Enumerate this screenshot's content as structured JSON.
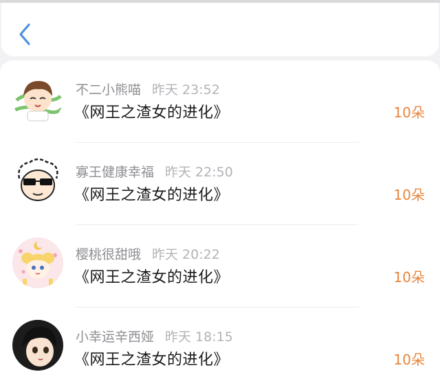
{
  "header": {
    "back_icon": "chevron-left-icon",
    "accent_color": "#4a90e2"
  },
  "list": {
    "items": [
      {
        "username": "不二小熊喵",
        "time": "昨天 23:52",
        "book_title": "《网王之渣女的进化》",
        "gift": "10朵",
        "avatar": "anime-boy-avatar"
      },
      {
        "username": "寡王健康幸福",
        "time": "昨天 22:50",
        "book_title": "《网王之渣女的进化》",
        "gift": "10朵",
        "avatar": "sunglasses-cartoon-avatar"
      },
      {
        "username": "樱桃很甜哦",
        "time": "昨天 20:22",
        "book_title": "《网王之渣女的进化》",
        "gift": "10朵",
        "avatar": "sailor-moon-avatar"
      },
      {
        "username": "小幸运辛西娅",
        "time": "昨天 18:15",
        "book_title": "《网王之渣女的进化》",
        "gift": "10朵",
        "avatar": "anime-girl-avatar"
      }
    ]
  },
  "colors": {
    "gift": "#e8843c",
    "username": "#8e8e93",
    "title": "#1a1a1a"
  }
}
